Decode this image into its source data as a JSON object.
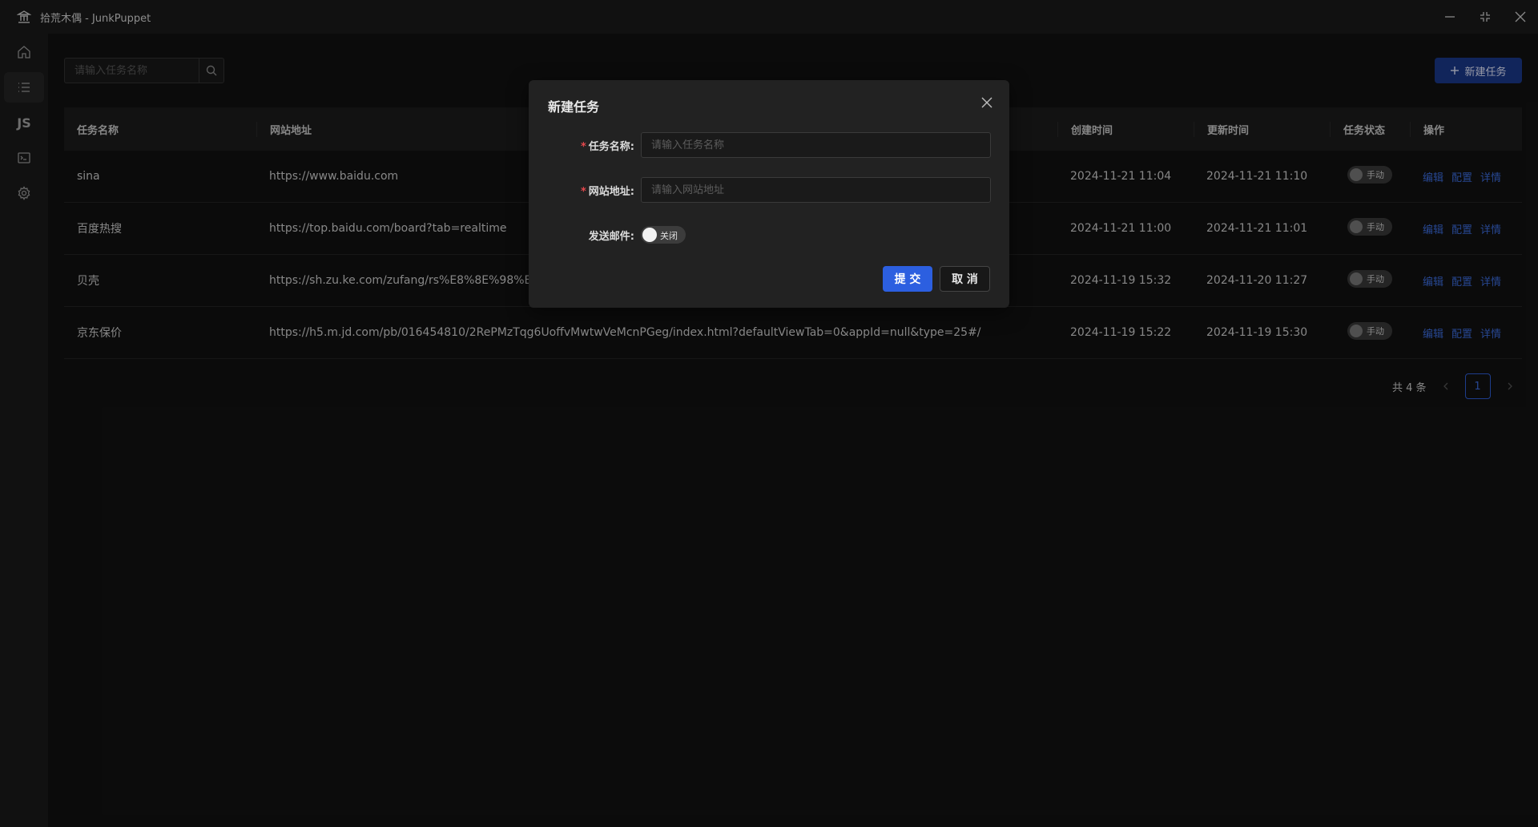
{
  "window": {
    "title": "拾荒木偶 - JunkPuppet",
    "logo_icon": "temple-icon"
  },
  "sidebar": {
    "items": [
      {
        "name": "home",
        "icon": "home-icon"
      },
      {
        "name": "tasks",
        "icon": "list-icon",
        "active": true
      },
      {
        "name": "scripts",
        "label": "JS"
      },
      {
        "name": "console",
        "icon": "terminal-icon"
      },
      {
        "name": "settings",
        "icon": "gear-icon"
      }
    ],
    "info_icon": "info-icon"
  },
  "toolbar": {
    "search_placeholder": "请输入任务名称",
    "new_task_label": "新建任务"
  },
  "table": {
    "headers": {
      "name": "任务名称",
      "url": "网站地址",
      "created": "创建时间",
      "updated": "更新时间",
      "status": "任务状态",
      "ops": "操作"
    },
    "rows": [
      {
        "name": "sina",
        "url": "https://www.baidu.com",
        "created": "2024-11-21 11:04",
        "updated": "2024-11-21 11:10",
        "status": "手动"
      },
      {
        "name": "百度热搜",
        "url": "https://top.baidu.com/board?tab=realtime",
        "created": "2024-11-21 11:00",
        "updated": "2024-11-21 11:01",
        "status": "手动"
      },
      {
        "name": "贝壳",
        "url": "https://sh.zu.ke.com/zufang/rs%E8%8E%98%E5%",
        "created": "2024-11-19 15:32",
        "updated": "2024-11-20 11:27",
        "status": "手动"
      },
      {
        "name": "京东保价",
        "url": "https://h5.m.jd.com/pb/016454810/2RePMzTqg6UoffvMwtwVeMcnPGeg/index.html?defaultViewTab=0&appId=null&type=25#/",
        "created": "2024-11-19 15:22",
        "updated": "2024-11-19 15:30",
        "status": "手动"
      }
    ],
    "ops": {
      "edit": "编辑",
      "config": "配置",
      "detail": "详情"
    }
  },
  "pagination": {
    "total_text": "共 4 条",
    "current_page": "1"
  },
  "modal": {
    "title": "新建任务",
    "name_label": "任务名称:",
    "name_placeholder": "请输入任务名称",
    "url_label": "网站地址:",
    "url_placeholder": "请输入网站地址",
    "mail_label": "发送邮件:",
    "mail_switch_label": "关闭",
    "submit_label": "提 交",
    "cancel_label": "取 消"
  },
  "colors": {
    "accent": "#2c5fe0",
    "required": "#e5484d",
    "link": "#3d6ee0"
  }
}
